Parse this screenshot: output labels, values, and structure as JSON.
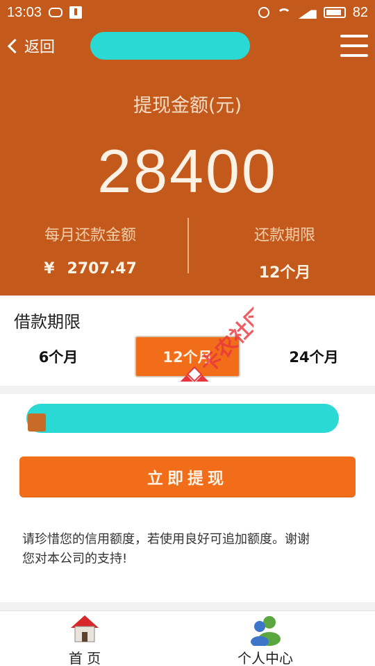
{
  "status_bar": {
    "time": "13:03",
    "battery": "82"
  },
  "nav": {
    "back_label": "返回"
  },
  "amount": {
    "label": "提现金额(元)",
    "value": "28400",
    "monthly_label": "每月还款金额",
    "monthly_currency": "¥",
    "monthly_value": "2707.47",
    "term_label": "还款期限",
    "term_value": "12个月"
  },
  "term_section": {
    "title": "借款期限",
    "options": [
      "6个月",
      "12个月",
      "24个月"
    ],
    "selected": "12个月"
  },
  "watermark": {
    "text": "卡农社区"
  },
  "form": {
    "button_label": "立即提现",
    "notice_line1": "请珍惜您的信用额度，若使用良好可追加额度。谢谢",
    "notice_line2": "您对本公司的支持!"
  },
  "tabs": [
    {
      "label": "首 页",
      "icon": "home-icon"
    },
    {
      "label": "个人中心",
      "icon": "users-icon"
    }
  ],
  "colors": {
    "accent": "#c4591c",
    "button": "#f26d1a",
    "redaction": "#2ad9d4"
  }
}
